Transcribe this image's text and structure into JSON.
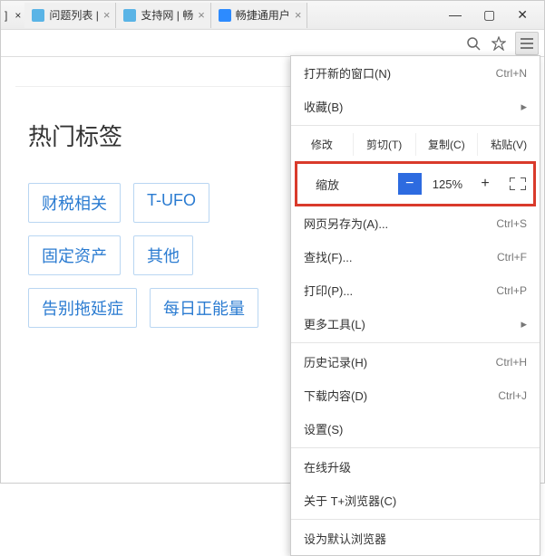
{
  "tabs": {
    "frag_left": "]",
    "t0": {
      "label": "问题列表 |"
    },
    "t1": {
      "label": "支持网 | 畅"
    },
    "t2": {
      "label": "畅捷通用户"
    }
  },
  "page": {
    "heading": "热门标签",
    "tags": [
      "财税相关",
      "T-UFO",
      "固定资产",
      "其他",
      "告别拖延症",
      "每日正能量"
    ]
  },
  "menu": {
    "new_window": "打开新的窗口(N)",
    "new_window_sc": "Ctrl+N",
    "favorites": "收藏(B)",
    "edit_label": "修改",
    "cut": "剪切(T)",
    "copy": "复制(C)",
    "paste": "粘贴(V)",
    "zoom_label": "缩放",
    "zoom_minus": "−",
    "zoom_value": "125%",
    "zoom_plus": "+",
    "save_as": "网页另存为(A)...",
    "save_as_sc": "Ctrl+S",
    "find": "查找(F)...",
    "find_sc": "Ctrl+F",
    "print": "打印(P)...",
    "print_sc": "Ctrl+P",
    "more_tools": "更多工具(L)",
    "history": "历史记录(H)",
    "history_sc": "Ctrl+H",
    "downloads": "下载内容(D)",
    "downloads_sc": "Ctrl+J",
    "settings": "设置(S)",
    "online_upgrade": "在线升级",
    "about": "关于 T+浏览器(C)",
    "set_default": "设为默认浏览器"
  }
}
